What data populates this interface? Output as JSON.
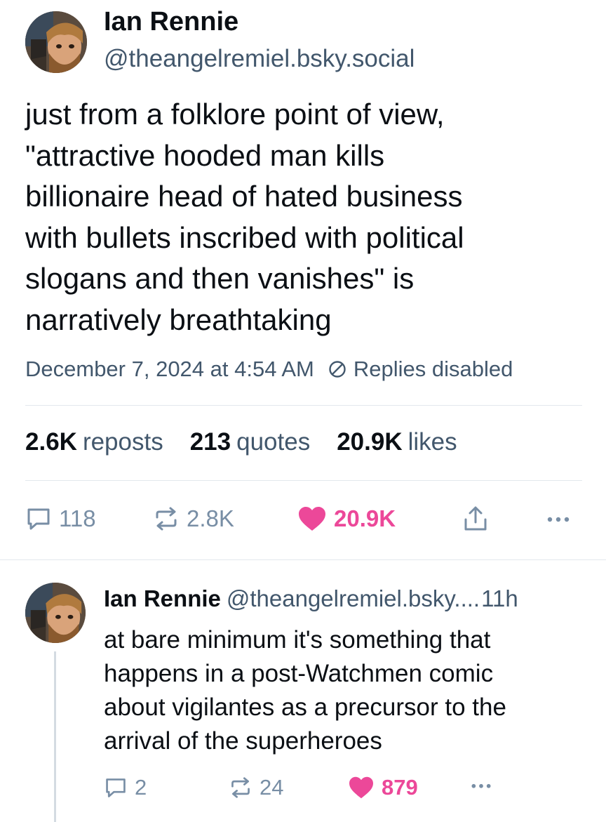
{
  "post": {
    "author_name": "Ian Rennie",
    "author_handle": "@theangelremiel.bsky.social",
    "text_lines": [
      "just from a folklore point of view,",
      "\"attractive hooded man kills",
      "billionaire head of hated business",
      "with bullets inscribed with political",
      "slogans and then vanishes\" is",
      "narratively breathtaking"
    ],
    "timestamp": "December 7, 2024 at 4:54 AM",
    "replies_status": "Replies disabled",
    "stats": {
      "reposts_count": "2.6K",
      "reposts_label": "reposts",
      "quotes_count": "213",
      "quotes_label": "quotes",
      "likes_count": "20.9K",
      "likes_label": "likes"
    },
    "actions": {
      "reply_count": "118",
      "repost_count": "2.8K",
      "like_count": "20.9K",
      "liked": true
    }
  },
  "reply": {
    "author_name": "Ian Rennie",
    "author_handle": "@theangelremiel.bsky....",
    "time": "11h",
    "text_lines": [
      "at bare minimum it's something that",
      "happens in a post-Watchmen comic",
      "about vigilantes as a precursor to the",
      "arrival of the superheroes"
    ],
    "actions": {
      "reply_count": "2",
      "repost_count": "24",
      "like_count": "879",
      "liked": true
    }
  },
  "colors": {
    "text": "#0b0f14",
    "secondary": "#42576c",
    "icon_muted": "#788ea5",
    "like_pink": "#ec4899",
    "divider": "#e3e8ed"
  },
  "icons": [
    "avatar",
    "circle-slash-icon",
    "reply-icon",
    "repost-icon",
    "heart-icon",
    "share-icon",
    "more-icon"
  ]
}
